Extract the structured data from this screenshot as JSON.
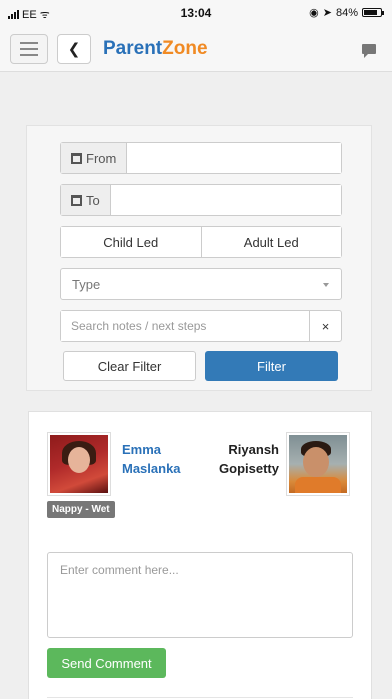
{
  "status_bar": {
    "carrier": "EE",
    "time": "13:04",
    "battery": "84%",
    "battery_level": 0.84
  },
  "navbar": {
    "brand_parent": "Parent",
    "brand_zone": "Zone",
    "back_glyph": "❮",
    "icons": [
      "menu-icon",
      "chevron-left-icon",
      "chat-icon"
    ],
    "brand_color": "#2a71b8",
    "brand_accent_color": "#f08a24"
  },
  "filter": {
    "from_label": "From",
    "to_label": "To",
    "child_led_label": "Child Led",
    "adult_led_label": "Adult Led",
    "type_placeholder": "Type",
    "search_placeholder": "Search notes / next steps",
    "clear_x": "×",
    "clear_filter_label": "Clear Filter",
    "filter_label": "Filter",
    "filter_color": "#337ab7"
  },
  "observation": {
    "staff_first": "Emma",
    "staff_last": "Maslanka",
    "child_first": "Riyansh",
    "child_last": "Gopisetty",
    "badge": "Nappy - Wet",
    "comment_placeholder": "Enter comment here...",
    "send_label": "Send Comment",
    "send_color": "#5cb85c"
  }
}
